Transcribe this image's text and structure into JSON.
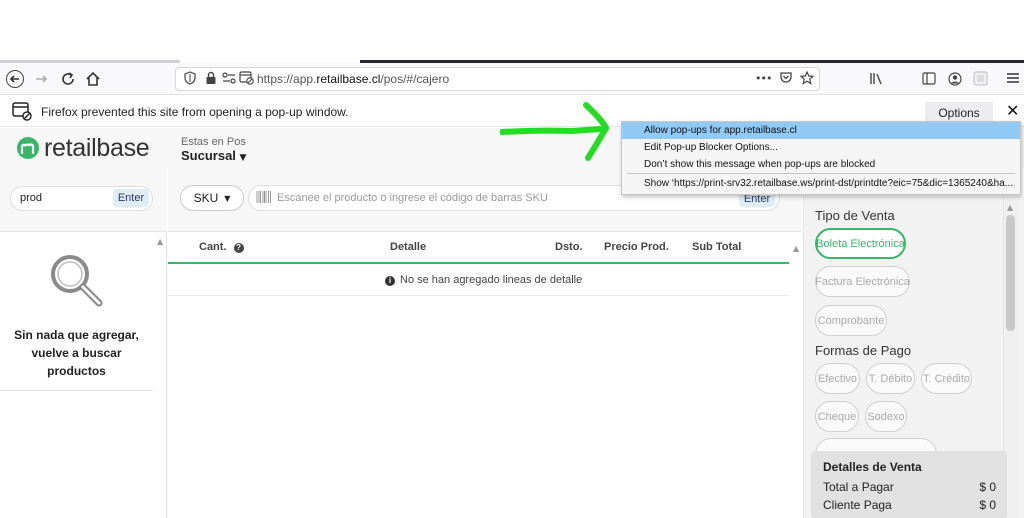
{
  "browser": {
    "url_prefix": "https://app.",
    "url_domain": "retailbase.cl",
    "url_path": "/pos/#/cajero",
    "more_label": "•••"
  },
  "notification": {
    "message": "Firefox prevented this site from opening a pop-up window.",
    "options_label": "Options",
    "menu": [
      "Allow pop-ups for app.retailbase.cl",
      "Edit Pop-up Blocker Options...",
      "Don’t show this message when pop-ups are blocked",
      "Show ‘https://print-srv32.retailbase.ws/print-dst/printdte?eic=75&dic=1365240&ha..."
    ]
  },
  "app": {
    "logo": "retailbase",
    "pos_label": "Estas en Pos",
    "branch": "Sucursal"
  },
  "search": {
    "value": "prod",
    "enter_label": "Enter",
    "empty_line1": "Sin nada que agregar,",
    "empty_line2": "vuelve a buscar",
    "empty_line3": "productos"
  },
  "scan": {
    "mode_label": "SKU",
    "placeholder": "Escanee el producto o ingrese el código de barras SKU",
    "enter_label": "Enter"
  },
  "table": {
    "headers": [
      "Cant.",
      "Detalle",
      "Dsto.",
      "Precio Prod.",
      "Sub Total"
    ],
    "empty_message": "No se han agregado lineas de detalle"
  },
  "sale": {
    "tipo_title": "Tipo de Venta",
    "tipos": [
      "Boleta Electrónica",
      "Factura Electrónica",
      "Comprobante"
    ],
    "pago_title": "Formas de Pago",
    "pagos": [
      "Efectivo",
      "T. Débito",
      "T. Crédito",
      "Cheque",
      "Sodexo"
    ],
    "detalle_title": "Detalles de Venta",
    "total_label": "Total a Pagar",
    "total_value": "$ 0",
    "cliente_label": "Cliente Paga",
    "cliente_value": "$ 0"
  },
  "colors": {
    "accent_green": "#3bb56a",
    "arrow_green": "#22dd22",
    "menu_highlight": "#91c9f7"
  }
}
